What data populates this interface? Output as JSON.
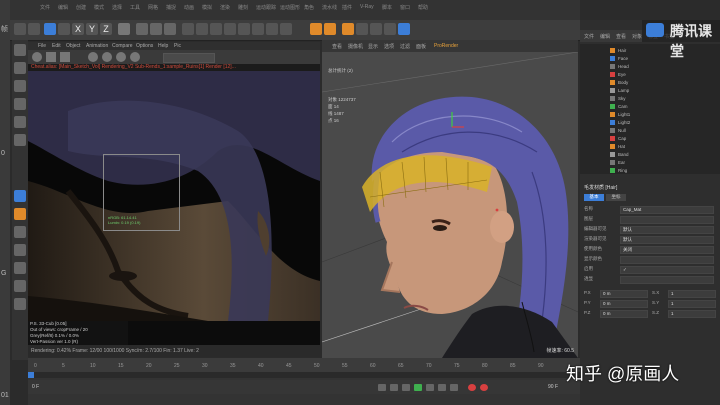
{
  "desktop": {
    "side_chars": [
      "帧",
      "0",
      "G",
      "01"
    ]
  },
  "menu": {
    "items": [
      "文件",
      "编辑",
      "创建",
      "模式",
      "选择",
      "工具",
      "网格",
      "捕捉",
      "动画",
      "模拟",
      "渲染",
      "雕刻",
      "运动跟踪",
      "运动图形",
      "角色",
      "流水线",
      "插件",
      "V-Ray",
      "脚本",
      "窗口",
      "帮助"
    ]
  },
  "toolbar": {
    "xyz": [
      "X",
      "Y",
      "Z"
    ]
  },
  "render_view": {
    "menu": [
      "File",
      "Edit",
      "Object",
      "Animation",
      "Compare",
      "Options",
      "Help",
      "Pic"
    ],
    "redline": "Cheat.alias: [Main_Sketch_Vol] Rendering_V2 Sub-Rends_1:sample_Ruins[1] Render [12]...",
    "region_box_text": [
      "nRGB: 61.14.41",
      "Lumin: 0.19 (0.19)"
    ],
    "info": [
      "P.S. 33-Cub [0.05]",
      "Out of views: cropFrame / 20",
      "Grey(Ref/8) 0.1% / 0.0%",
      "Vert-Passion ver 1.0 (R)"
    ],
    "status": "Rendering: 0.42%  Frame: 12/00  100/1000  Sync/m: 2.7/100  Fin: 1.37  Live: 2"
  },
  "editor_view": {
    "menu": [
      "查看",
      "摄像机",
      "显示",
      "选项",
      "过滤",
      "面板",
      "ProRender"
    ],
    "stats_title": "总计统计 (2)",
    "stats_lines": [
      "对象 1224737",
      "面 14",
      "线 1487",
      "点 16"
    ],
    "table": [
      "对象",
      "面",
      "边",
      "点"
    ],
    "fps": "帧速率: 60.5"
  },
  "right_panel": {
    "header_items": [
      "文件",
      "编辑",
      "查看",
      "对象",
      "标签",
      "书签"
    ],
    "object_names": [
      "Hair",
      "Face",
      "Head",
      "Eye",
      "Body",
      "Lamp",
      "Sky",
      "Cam",
      "Light1",
      "Light2",
      "Null",
      "Cap",
      "Hat",
      "Band",
      "Ear",
      "Ring"
    ]
  },
  "attributes": {
    "header": "毛发材质 [Hair]",
    "tabs": [
      "基本",
      "坐标"
    ],
    "rows": [
      {
        "label": "名称",
        "value": "Cap_Mat"
      },
      {
        "label": "图层",
        "value": ""
      },
      {
        "label": "编辑器可见",
        "value": "默认"
      },
      {
        "label": "渲染器可见",
        "value": "默认"
      },
      {
        "label": "使用颜色",
        "value": "关闭"
      },
      {
        "label": "显示颜色",
        "value": ""
      },
      {
        "label": "启用",
        "value": "✓"
      },
      {
        "label": "透显",
        "value": ""
      }
    ],
    "coords": [
      {
        "label": "P.X",
        "value": "0 m"
      },
      {
        "label": "P.Y",
        "value": "0 m"
      },
      {
        "label": "P.Z",
        "value": "0 m"
      },
      {
        "label": "S.X",
        "value": "1"
      },
      {
        "label": "S.Y",
        "value": "1"
      },
      {
        "label": "S.Z",
        "value": "1"
      }
    ]
  },
  "brand": {
    "text": "腾讯课堂"
  },
  "timeline": {
    "ticks": [
      "0",
      "5",
      "10",
      "15",
      "20",
      "25",
      "30",
      "35",
      "40",
      "45",
      "50",
      "55",
      "60",
      "65",
      "70",
      "75",
      "80",
      "85",
      "90"
    ],
    "current": "0 F",
    "end": "90 F"
  },
  "watermark": {
    "text": "知乎 @原画人"
  },
  "colors": {
    "accent_orange": "#e08a2a",
    "accent_blue": "#3c7ed8",
    "hair_purple": "#5a5aa8",
    "wire_yellow": "#d8b228"
  }
}
